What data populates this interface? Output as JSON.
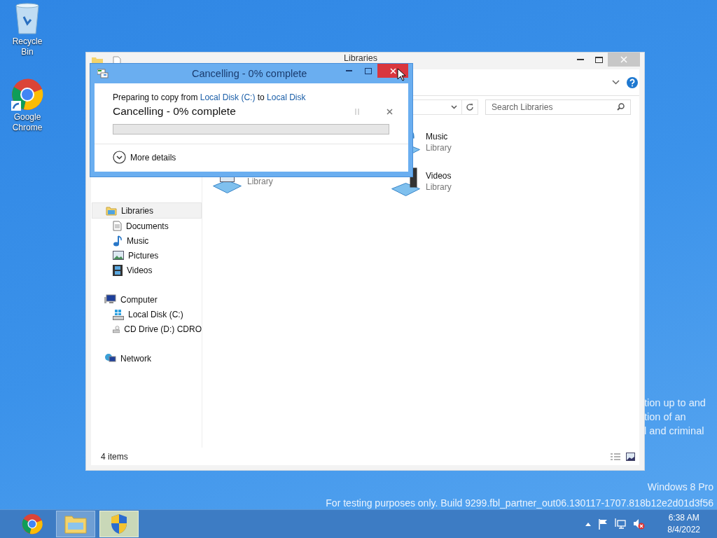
{
  "desktop_icons": [
    {
      "label": "Recycle Bin",
      "kind": "recycle"
    },
    {
      "label": "Google Chrome",
      "kind": "chrome"
    }
  ],
  "desktop_notice": [
    "tion up to and",
    "tion of an",
    "l and criminal"
  ],
  "explorer": {
    "title": "Libraries",
    "search": {
      "placeholder": "Search Libraries"
    },
    "tiles": [
      {
        "name": "Music",
        "sub": "Library",
        "kind": "music"
      },
      {
        "sub": "Library",
        "kind": "pictures"
      },
      {
        "name": "Videos",
        "sub": "Library",
        "kind": "videos"
      }
    ],
    "nav": [
      {
        "label": "Libraries",
        "kind": "libraries",
        "selected": true,
        "children": [
          {
            "label": "Documents",
            "kind": "documents",
            "selected": false
          },
          {
            "label": "Music",
            "kind": "music",
            "selected": false
          },
          {
            "label": "Pictures",
            "kind": "pictures",
            "selected": false
          },
          {
            "label": "Videos",
            "kind": "videos",
            "selected": false
          }
        ]
      },
      {
        "label": "Computer",
        "kind": "computer",
        "selected": false,
        "children": [
          {
            "label": "Local Disk (C:)",
            "kind": "disk",
            "selected": false
          },
          {
            "label": "CD Drive (D:) CDRO",
            "kind": "cd",
            "selected": false
          }
        ]
      },
      {
        "label": "Network",
        "kind": "network",
        "selected": false
      }
    ],
    "status": "4 items"
  },
  "dialog": {
    "title": "Cancelling - 0% complete",
    "message": [
      {
        "kind": "plain",
        "text": "Preparing to copy from "
      },
      {
        "kind": "link",
        "text": "Local Disk (C:)"
      },
      {
        "kind": "plain",
        "text": " to "
      },
      {
        "kind": "link",
        "text": "Local Disk"
      }
    ],
    "status": "Cancelling - 0% complete",
    "progress": {
      "level": 0
    },
    "details": "More details"
  },
  "watermark": [
    "Windows 8 Pro",
    "For testing purposes only. Build 9299.fbl_partner_out06.130117-1707.818b12e2d01d3f56"
  ],
  "taskbar": {
    "apps": [
      {
        "kind": "chrome",
        "running": false,
        "selected": false
      },
      {
        "kind": "explorer",
        "running": true,
        "selected": false
      },
      {
        "kind": "shield",
        "running": true,
        "selected": true
      }
    ],
    "time": "6:38 AM",
    "date": "8/4/2022"
  }
}
